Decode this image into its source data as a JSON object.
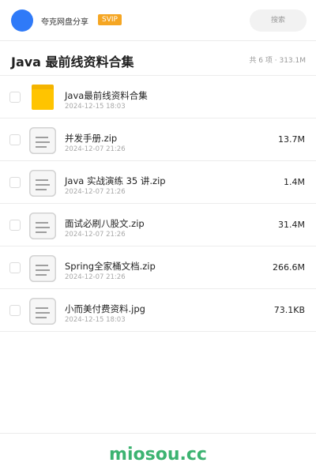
{
  "colors": {
    "avatar": "#2f7af8",
    "svip_badge": "#f5a623",
    "folder_icon": "#ffc400",
    "brand": "#3cb371"
  },
  "header": {
    "app_name": "夸克网盘分享",
    "badge": "SVIP",
    "search_label": "搜索"
  },
  "folder": {
    "title": "Java 最前线资料合集",
    "summary": "共 6 项 · 313.1M"
  },
  "files": [
    {
      "name": "Java最前线资料合集",
      "date": "2024-12-15 18:03",
      "size": "",
      "icon": "folder-icon"
    },
    {
      "name": "并发手册.zip",
      "date": "2024-12-07 21:26",
      "size": "13.7M",
      "icon": "file-icon"
    },
    {
      "name": "Java 实战演练 35 讲.zip",
      "date": "2024-12-07 21:26",
      "size": "1.4M",
      "icon": "file-icon"
    },
    {
      "name": "面试必刷八股文.zip",
      "date": "2024-12-07 21:26",
      "size": "31.4M",
      "icon": "file-icon"
    },
    {
      "name": "Spring全家桶文档.zip",
      "date": "2024-12-07 21:26",
      "size": "266.6M",
      "icon": "file-icon"
    },
    {
      "name": "小而美付费资料.jpg",
      "date": "2024-12-15 18:03",
      "size": "73.1KB",
      "icon": "file-icon"
    }
  ],
  "footer": {
    "brand": "miosou.cc"
  }
}
